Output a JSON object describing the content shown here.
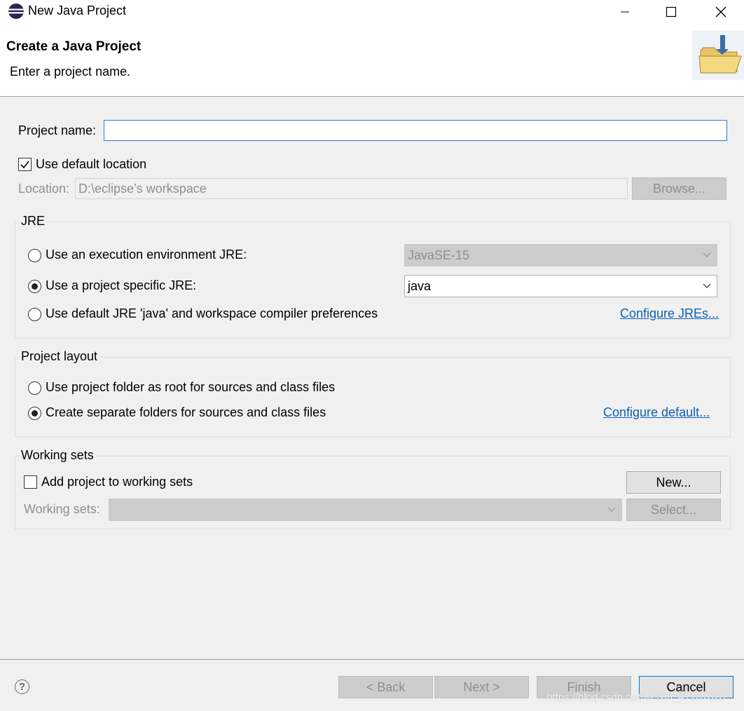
{
  "window": {
    "title": "New Java Project",
    "icon": "eclipse-icon"
  },
  "banner": {
    "title": "Create a Java Project",
    "message": "Enter a project name.",
    "image": "new-project-folder-icon"
  },
  "project_name": {
    "label": "Project name:",
    "value": ""
  },
  "location": {
    "use_default_label": "Use default location",
    "use_default_checked": true,
    "label": "Location:",
    "value": "D:\\eclipse’s workspace",
    "browse_label": "Browse..."
  },
  "jre": {
    "group_title": "JRE",
    "options": [
      {
        "label": "Use an execution environment JRE:",
        "selected": false
      },
      {
        "label": "Use a project specific JRE:",
        "selected": true
      },
      {
        "label": "Use default JRE 'java' and workspace compiler preferences",
        "selected": false
      }
    ],
    "execution_env_value": "JavaSE-15",
    "project_jre_value": "java",
    "configure_link": "Configure JREs..."
  },
  "layout": {
    "group_title": "Project layout",
    "options": [
      {
        "label": "Use project folder as root for sources and class files",
        "selected": false
      },
      {
        "label": "Create separate folders for sources and class files",
        "selected": true
      }
    ],
    "configure_link": "Configure default..."
  },
  "working_sets": {
    "group_title": "Working sets",
    "add_label": "Add project to working sets",
    "add_checked": false,
    "new_label": "New...",
    "sets_label": "Working sets:",
    "sets_value": "",
    "select_label": "Select..."
  },
  "footer": {
    "help": "?",
    "back_label": "< Back",
    "next_label": "Next >",
    "finish_label": "Finish",
    "cancel_label": "Cancel"
  },
  "watermark": "https://blog.csdn.net/weixin_47287620"
}
